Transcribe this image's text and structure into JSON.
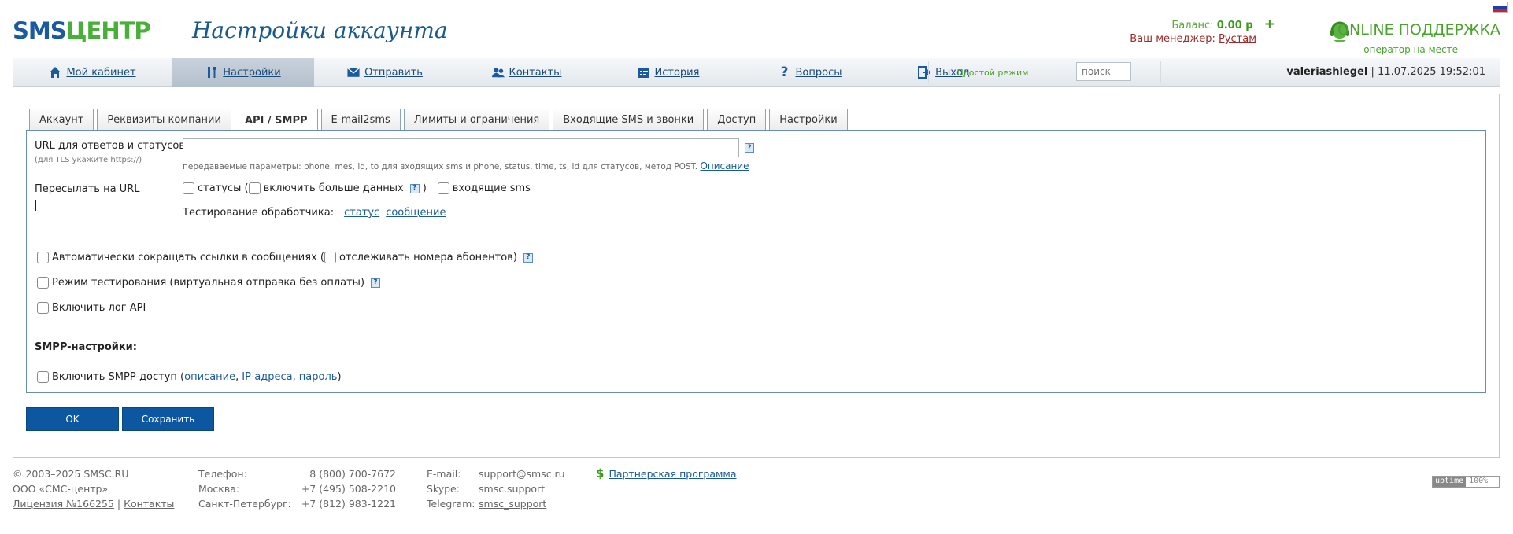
{
  "header": {
    "logo_sms": "SMS",
    "logo_centr": "ЦЕНТР",
    "page_title": "Настройки аккаунта",
    "balance_label": "Баланс:",
    "balance_value": "0.00 р",
    "balance_add": "+",
    "manager_label": "Ваш менеджер:",
    "manager_name": "Рустам",
    "support_title": "ONLINE ПОДДЕРЖКА",
    "support_sub": "оператор на месте"
  },
  "nav": {
    "items": [
      {
        "label": "Мой кабинет",
        "icon": "home-icon"
      },
      {
        "label": "Настройки",
        "icon": "tools-icon"
      },
      {
        "label": "Отправить",
        "icon": "envelope-icon"
      },
      {
        "label": "Контакты",
        "icon": "contacts-icon"
      },
      {
        "label": "История",
        "icon": "calendar-icon"
      },
      {
        "label": "Вопросы",
        "icon": "question-icon"
      },
      {
        "label": "Выход",
        "icon": "logout-icon"
      }
    ],
    "simple_mode": "Простой режим",
    "search_placeholder": "поиск",
    "username": "valeriashlegel",
    "separator": "|",
    "datetime": "11.07.2025 19:52:01"
  },
  "tabs": [
    {
      "label": "Аккаунт"
    },
    {
      "label": "Реквизиты компании"
    },
    {
      "label": "API / SMPP"
    },
    {
      "label": "E-mail2sms"
    },
    {
      "label": "Лимиты и ограничения"
    },
    {
      "label": "Входящие SMS и звонки"
    },
    {
      "label": "Доступ"
    },
    {
      "label": "Настройки"
    }
  ],
  "form": {
    "url_label": "URL для ответов и статусов",
    "url_tls_hint": "(для TLS укажите https://)",
    "url_value": "",
    "help_glyph": "?",
    "params_hint": "передаваемые параметры: phone, mes, id, to для входящих sms и phone, status, time, ts, id для статусов, метод POST.",
    "params_link": "Описание",
    "forward_label": "Пересылать на URL",
    "cb_statuses": "статусы (",
    "cb_more_data": "включить больше данных",
    "close_paren": ")",
    "cb_incoming": "входящие sms",
    "test_label": "Тестирование обработчика:",
    "test_status": "статус",
    "test_message": "сообщение",
    "cb_shorten": "Автоматически сокращать ссылки в сообщениях (",
    "cb_track": "отслеживать номера абонентов)",
    "cb_test_mode": "Режим тестирования (виртуальная отправка без оплаты)",
    "cb_api_log": "Включить лог API",
    "smpp_title": "SMPP-настройки:",
    "cb_smpp": "Включить SMPP-доступ (",
    "smpp_desc": "описание",
    "comma": ",",
    "smpp_ip": "IP-адреса",
    "smpp_pass": "пароль",
    "smpp_close": ")"
  },
  "buttons": {
    "ok": "OK",
    "save": "Сохранить"
  },
  "footer": {
    "copyright": "© 2003–2025 SMSC.RU",
    "company": "ООО «СМС-центр»",
    "license": "Лицензия №166255",
    "pipe": "|",
    "contacts": "Контакты",
    "phone_label": "Телефон:",
    "phone_value": "8 (800) 700-7672",
    "moscow_label": "Москва:",
    "moscow_value": "+7 (495) 508-2210",
    "spb_label": "Санкт-Петербург:",
    "spb_value": "+7 (812) 983-1221",
    "email_label": "E-mail:",
    "email_value": "support@smsc.ru",
    "skype_label": "Skype:",
    "skype_value": "smsc.support",
    "telegram_label": "Telegram:",
    "telegram_value": "smsc_support",
    "partner": "Партнерская программа",
    "uptime_label": "uptime",
    "uptime_value": "100%"
  },
  "colors": {
    "brand_blue": "#1a5aa0",
    "brand_green": "#48b038",
    "button_blue": "#0d57a0",
    "link_blue": "#1a5a9a"
  }
}
